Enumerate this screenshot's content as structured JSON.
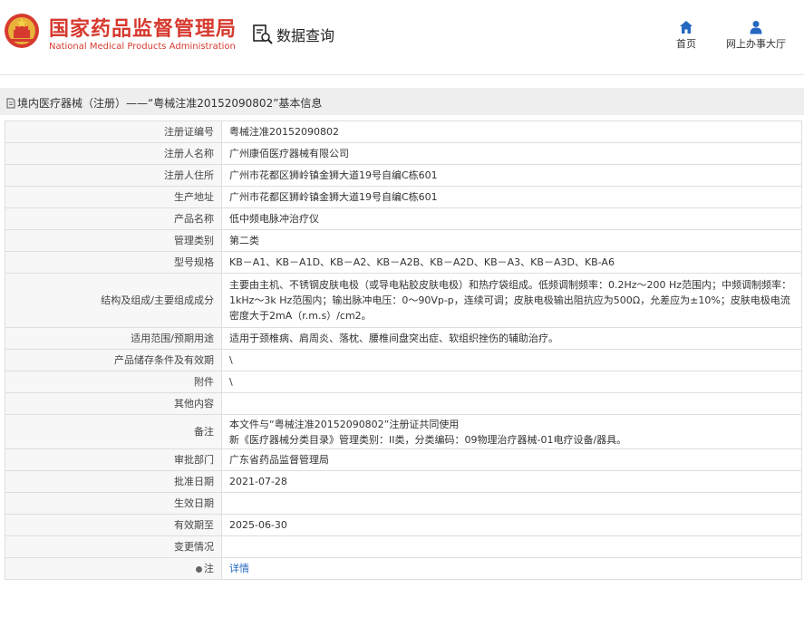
{
  "header": {
    "logo_cn": "国家药品监督管理局",
    "logo_en": "National Medical Products Administration",
    "query_label": "数据查询",
    "nav_home": "首页",
    "nav_hall": "网上办事大厅"
  },
  "breadcrumb": "境内医疗器械（注册）——“粤械注准20152090802”基本信息",
  "colors": {
    "brand_red": "#d63a2f",
    "nav_blue": "#2468c0",
    "link_blue": "#2468c0"
  },
  "rows": [
    {
      "label": "注册证编号",
      "value": "粤械注准20152090802"
    },
    {
      "label": "注册人名称",
      "value": "广州康佰医疗器械有限公司"
    },
    {
      "label": "注册人住所",
      "value": "广州市花都区狮岭镇金狮大道19号自编C栋601"
    },
    {
      "label": "生产地址",
      "value": "广州市花都区狮岭镇金狮大道19号自编C栋601"
    },
    {
      "label": "产品名称",
      "value": "低中频电脉冲治疗仪"
    },
    {
      "label": "管理类别",
      "value": "第二类"
    },
    {
      "label": "型号规格",
      "value": "KB－A1、KB－A1D、KB－A2、KB－A2B、KB－A2D、KB－A3、KB－A3D、KB-A6"
    },
    {
      "label": "结构及组成/主要组成成分",
      "value": "主要由主机、不锈钢皮肤电极（或导电粘胶皮肤电极）和热疗袋组成。低频调制频率：0.2Hz～200 Hz范围内；中频调制频率：1kHz～3k Hz范围内；输出脉冲电压：0～90Vp-p，连续可调；皮肤电极输出阻抗应为500Ω，允差应为±10%；皮肤电极电流密度大于2mA（r.m.s）/cm2。"
    },
    {
      "label": "适用范围/预期用途",
      "value": "适用于颈椎病、肩周炎、落枕、腰椎间盘突出症、软组织挫伤的辅助治疗。"
    },
    {
      "label": "产品储存条件及有效期",
      "value": "\\"
    },
    {
      "label": "附件",
      "value": "\\"
    },
    {
      "label": "其他内容",
      "value": ""
    },
    {
      "label": "备注",
      "value_line1": "本文件与“粤械注准20152090802”注册证共同使用",
      "value_line2": "新《医疗器械分类目录》管理类别：II类，分类编码：09物理治疗器械-01电疗设备/器具。"
    },
    {
      "label": "审批部门",
      "value": "广东省药品监督管理局"
    },
    {
      "label": "批准日期",
      "value": "2021-07-28"
    },
    {
      "label": "生效日期",
      "value": ""
    },
    {
      "label": "有效期至",
      "value": "2025-06-30"
    },
    {
      "label": "变更情况",
      "value": ""
    },
    {
      "label": "注",
      "value": "详情"
    }
  ]
}
